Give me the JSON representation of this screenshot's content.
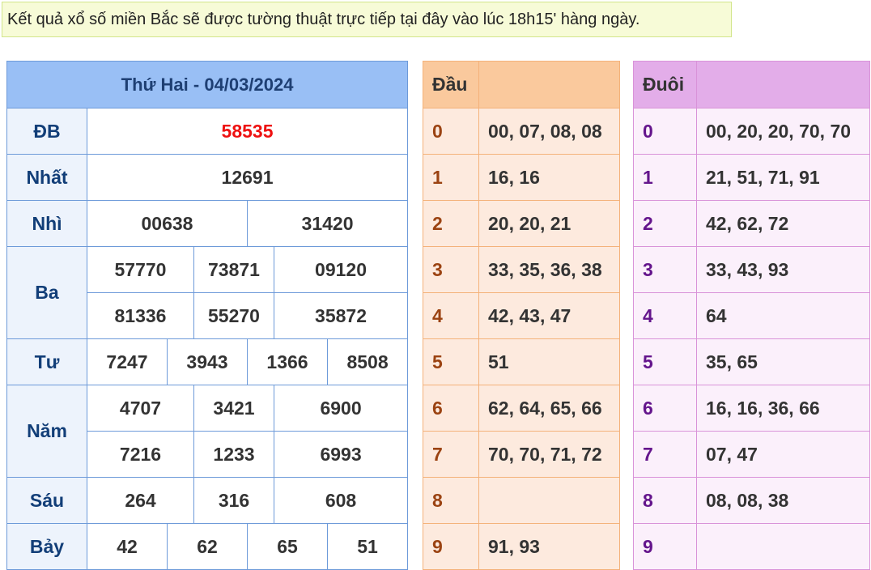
{
  "notice": "Kết quả xổ số miền Bắc sẽ được tường thuật trực tiếp tại đây vào lúc 18h15' hàng ngày.",
  "results": {
    "title": "Thứ Hai - 04/03/2024",
    "db_label": "ĐB",
    "db": [
      "58535"
    ],
    "nhat_label": "Nhất",
    "nhat": [
      "12691"
    ],
    "nhi_label": "Nhì",
    "nhi": [
      "00638",
      "31420"
    ],
    "ba_label": "Ba",
    "ba": [
      "57770",
      "73871",
      "09120",
      "81336",
      "55270",
      "35872"
    ],
    "tu_label": "Tư",
    "tu": [
      "7247",
      "3943",
      "1366",
      "8508"
    ],
    "nam_label": "Năm",
    "nam": [
      "4707",
      "3421",
      "6900",
      "7216",
      "1233",
      "6993"
    ],
    "sau_label": "Sáu",
    "sau": [
      "264",
      "316",
      "608"
    ],
    "bay_label": "Bảy",
    "bay": [
      "42",
      "62",
      "65",
      "51"
    ]
  },
  "dau": {
    "header": "Đầu",
    "rows": [
      {
        "key": "0",
        "value": "00, 07, 08, 08"
      },
      {
        "key": "1",
        "value": "16, 16"
      },
      {
        "key": "2",
        "value": "20, 20, 21"
      },
      {
        "key": "3",
        "value": "33, 35, 36, 38"
      },
      {
        "key": "4",
        "value": "42, 43, 47"
      },
      {
        "key": "5",
        "value": "51"
      },
      {
        "key": "6",
        "value": "62, 64, 65, 66"
      },
      {
        "key": "7",
        "value": "70, 70, 71, 72"
      },
      {
        "key": "8",
        "value": ""
      },
      {
        "key": "9",
        "value": "91, 93"
      }
    ]
  },
  "duoi": {
    "header": "Đuôi",
    "rows": [
      {
        "key": "0",
        "value": "00, 20, 20, 70, 70"
      },
      {
        "key": "1",
        "value": "21, 51, 71, 91"
      },
      {
        "key": "2",
        "value": "42, 62, 72"
      },
      {
        "key": "3",
        "value": "33, 43, 93"
      },
      {
        "key": "4",
        "value": "64"
      },
      {
        "key": "5",
        "value": "35, 65"
      },
      {
        "key": "6",
        "value": "16, 16, 36, 66"
      },
      {
        "key": "7",
        "value": "07, 47"
      },
      {
        "key": "8",
        "value": "08, 08, 38"
      },
      {
        "key": "9",
        "value": ""
      }
    ]
  }
}
